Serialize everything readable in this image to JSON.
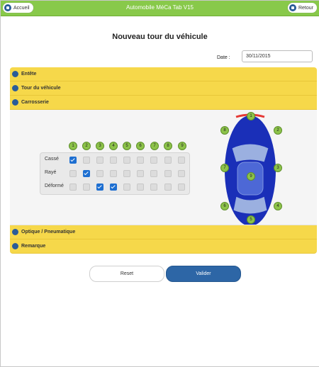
{
  "app": {
    "title": "Automobile MéCa Tab V15",
    "home_label": "Accueil",
    "back_label": "Retour",
    "accent_color": "#88c94a"
  },
  "page": {
    "title": "Nouveau tour du véhicule"
  },
  "date": {
    "label": "Date :",
    "value": "30/11/2015"
  },
  "sections": {
    "entete": "Entête",
    "tour": "Tour du véhicule",
    "carrosserie": "Carrosserie",
    "optique": "Optique / Pneumatique",
    "remarque": "Remarque"
  },
  "damage_table": {
    "columns": [
      "1",
      "2",
      "3",
      "4",
      "5",
      "6",
      "7",
      "8",
      "9"
    ],
    "rows": [
      {
        "label": "Cassé",
        "checked": [
          true,
          false,
          false,
          false,
          false,
          false,
          false,
          false,
          false
        ]
      },
      {
        "label": "Rayé",
        "checked": [
          false,
          true,
          false,
          false,
          false,
          false,
          false,
          false,
          false
        ]
      },
      {
        "label": "Déformé",
        "checked": [
          false,
          false,
          true,
          true,
          false,
          false,
          false,
          false,
          false
        ]
      }
    ]
  },
  "car_zones": [
    "1",
    "2",
    "3",
    "4",
    "5",
    "6",
    "7",
    "8",
    "9"
  ],
  "actions": {
    "reset": "Reset",
    "submit": "Valider"
  }
}
